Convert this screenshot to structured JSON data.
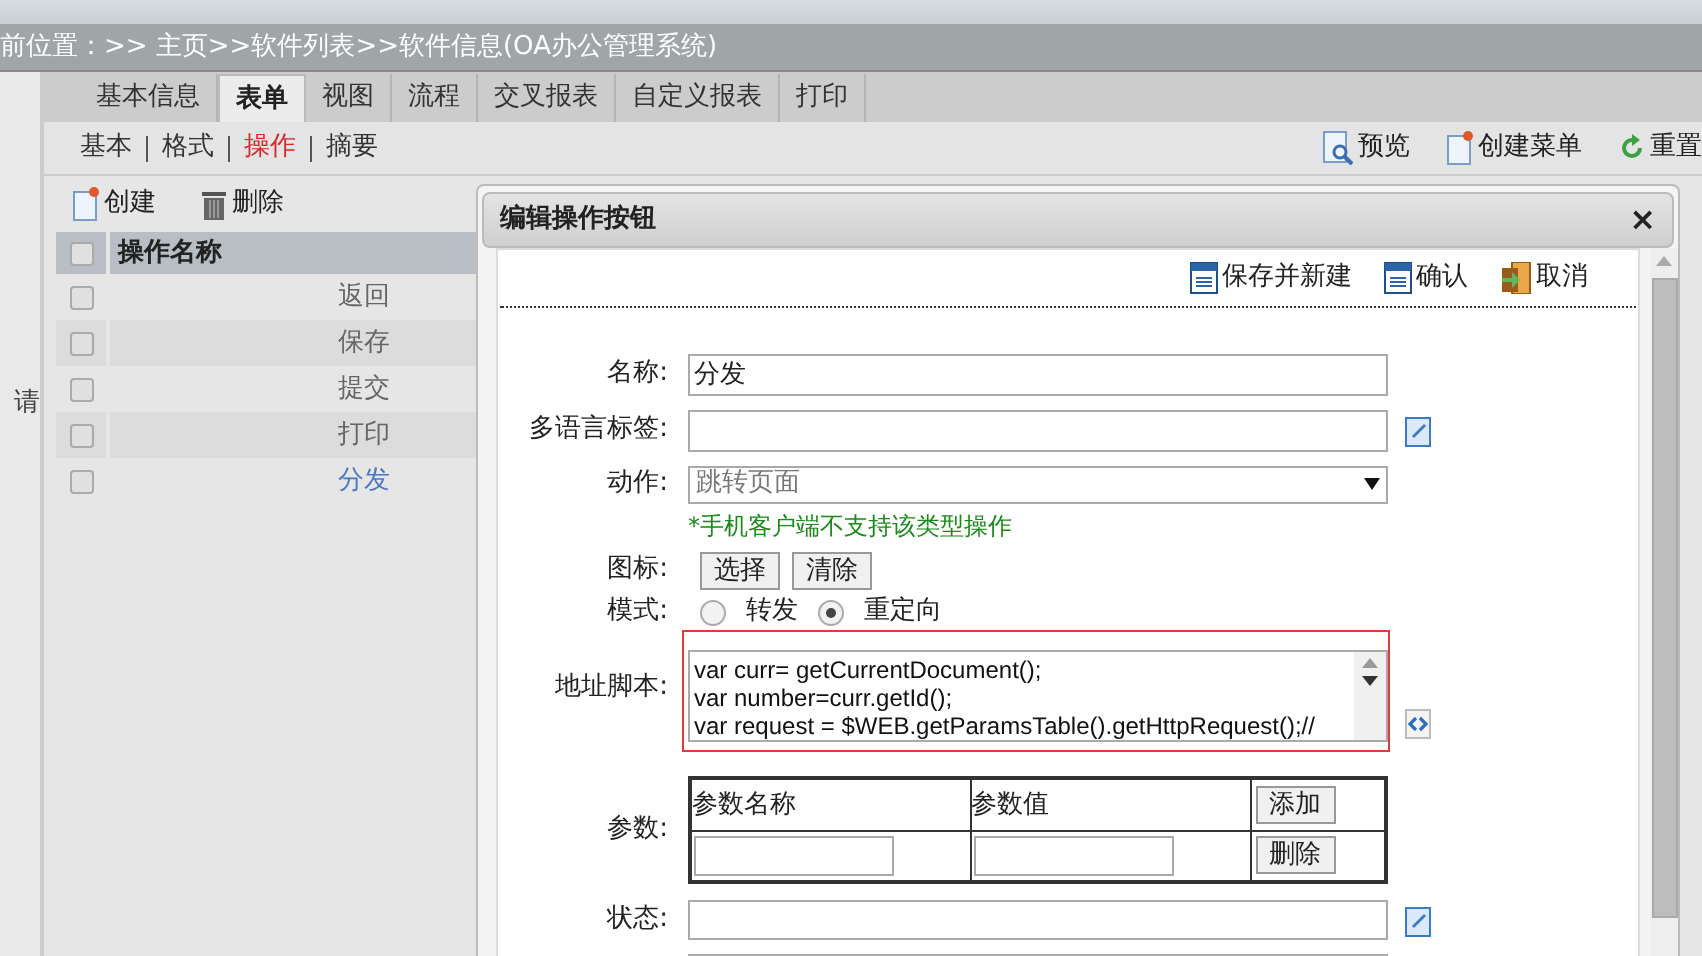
{
  "breadcrumb": "前位置：>> 主页>>软件列表>>软件信息(OA办公管理系统)",
  "left_gutter_text": "请",
  "tabs": [
    {
      "label": "基本信息",
      "selected": false
    },
    {
      "label": "表单",
      "selected": true
    },
    {
      "label": "视图",
      "selected": false
    },
    {
      "label": "流程",
      "selected": false
    },
    {
      "label": "交叉报表",
      "selected": false
    },
    {
      "label": "自定义报表",
      "selected": false
    },
    {
      "label": "打印",
      "selected": false
    }
  ],
  "subtabs": [
    {
      "label": "基本",
      "selected": false
    },
    {
      "label": "格式",
      "selected": false
    },
    {
      "label": "操作",
      "selected": true
    },
    {
      "label": "摘要",
      "selected": false
    }
  ],
  "page_actions": [
    {
      "kind": "preview",
      "label": "预览"
    },
    {
      "kind": "create",
      "label": "创建菜单"
    },
    {
      "kind": "reset",
      "label": "重置"
    }
  ],
  "list_toolbar": [
    {
      "kind": "create",
      "label": "创建"
    },
    {
      "kind": "delete",
      "label": "删除"
    }
  ],
  "table": {
    "column": "操作名称",
    "all_checked": false,
    "rows": [
      {
        "name": "返回",
        "checked": false,
        "selected": false
      },
      {
        "name": "保存",
        "checked": false,
        "selected": false
      },
      {
        "name": "提交",
        "checked": false,
        "selected": false
      },
      {
        "name": "打印",
        "checked": false,
        "selected": false
      },
      {
        "name": "分发",
        "checked": false,
        "selected": true
      }
    ]
  },
  "dialog": {
    "title": "编辑操作按钮",
    "close": "×",
    "toolbar": [
      {
        "kind": "save",
        "label": "保存并新建"
      },
      {
        "kind": "save",
        "label": "确认"
      },
      {
        "kind": "exit",
        "label": "取消"
      }
    ],
    "name": {
      "label": "名称:",
      "value": "分发"
    },
    "i18n": {
      "label": "多语言标签:"
    },
    "action": {
      "label": "动作:",
      "value": "跳转页面"
    },
    "note": "*手机客户端不支持该类型操作",
    "icon": {
      "label": "图标:",
      "buttons": [
        "选择",
        "清除"
      ]
    },
    "mode": {
      "label": "模式:",
      "options": [
        {
          "label": "转发",
          "selected": false
        },
        {
          "label": "重定向",
          "selected": true
        }
      ]
    },
    "script": {
      "label": "地址脚本:",
      "lines": [
        "var curr= getCurrentDocument();",
        "var number=curr.getId();",
        "var request = $WEB.getParamsTable().getHttpRequest();//"
      ],
      "highlighted": true
    },
    "params": {
      "label": "参数:",
      "columns": [
        "参数名称",
        "参数值"
      ],
      "add": "添加",
      "delete": "删除"
    },
    "status": {
      "label": "状态:"
    }
  }
}
